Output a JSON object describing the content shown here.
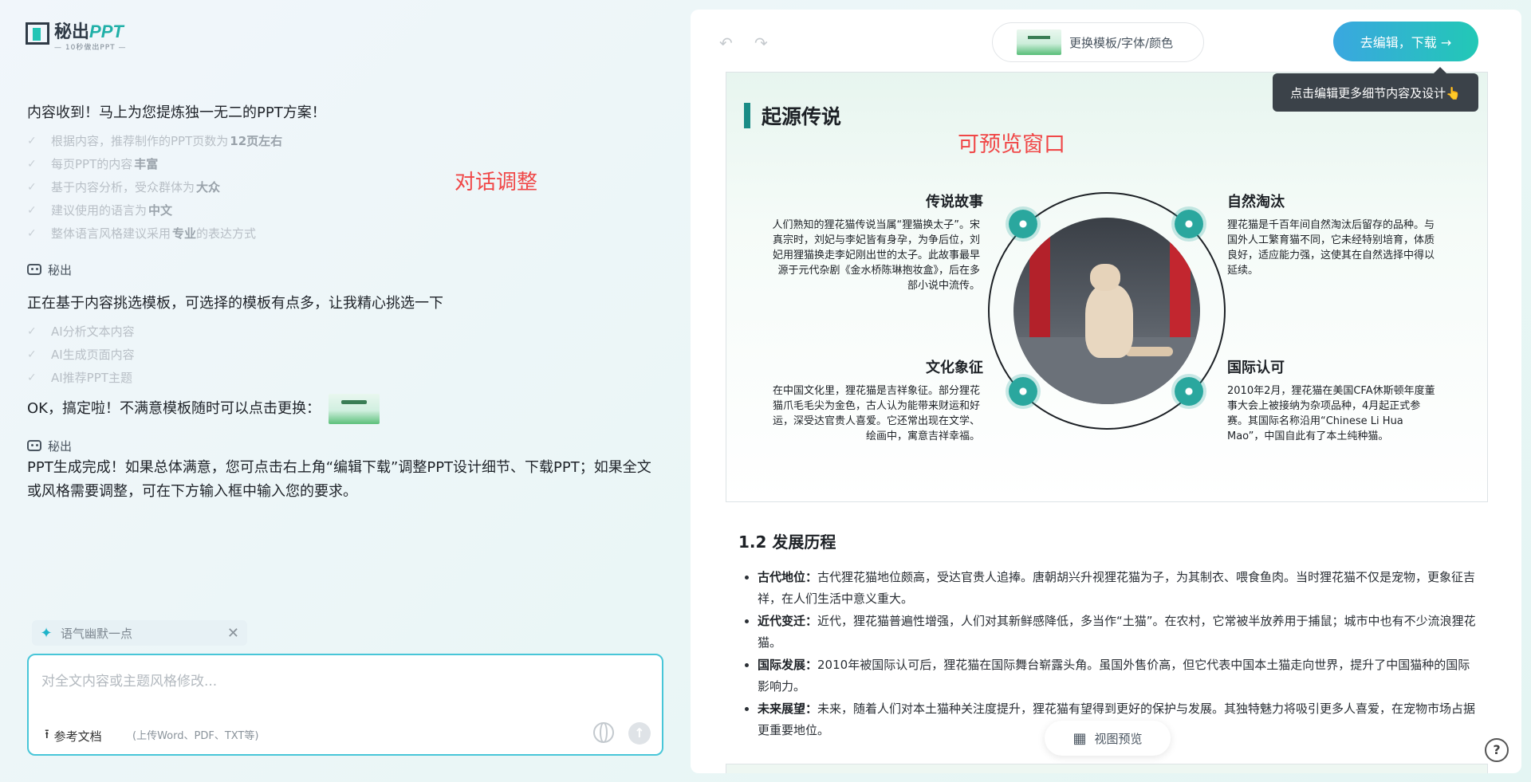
{
  "logo": {
    "brand": "秘出",
    "ppt": "PPT",
    "tagline": "— 10秒做出PPT —"
  },
  "chat": {
    "intro": "内容收到！马上为您提炼独一无二的PPT方案！",
    "checks": [
      {
        "text": "根据内容，推荐制作的PPT页数为",
        "bold": "12页左右"
      },
      {
        "text": "每页PPT的内容",
        "bold": "丰富"
      },
      {
        "text": "基于内容分析，受众群体为",
        "bold": "大众"
      },
      {
        "text": "建议使用的语言为",
        "bold": "中文"
      },
      {
        "text": "整体语言风格建议采用",
        "bold": "专业",
        "suffix": "的表达方式"
      }
    ],
    "bot_name": "秘出",
    "picking": "正在基于内容挑选模板，可选择的模板有点多，让我精心挑选一下",
    "steps": [
      "AI分析文本内容",
      "AI生成页面内容",
      "AI推荐PPT主题"
    ],
    "ok": "OK，搞定啦！不满意模板随时可以点击更换：",
    "bot_name_2": "秘出",
    "final": "PPT生成完成！如果总体满意，您可点击右上角“编辑下载”调整PPT设计细节、下载PPT；如果全文或风格需要调整，可在下方输入框中输入您的要求。"
  },
  "annotations": {
    "left": "对话调整",
    "right": "可预览窗口"
  },
  "input": {
    "chip": "语气幽默一点",
    "placeholder": "对全文内容或主题风格修改...",
    "ref_label": "参考文档",
    "ref_hint": "(上传Word、PDF、TXT等)"
  },
  "toolbar": {
    "template_label": "更换模板/字体/颜色",
    "edit_label": "去编辑，下载 →",
    "tooltip": "点击编辑更多细节内容及设计👆"
  },
  "slide": {
    "title": "起源传说",
    "sections": [
      {
        "heading": "传说故事",
        "body": "人们熟知的狸花猫传说当属“狸猫换太子”。宋真宗时，刘妃与李妃皆有身孕，为争后位，刘妃用狸猫换走李妃刚出世的太子。此故事最早源于元代杂剧《金水桥陈琳抱妆盒》，后在多部小说中流传。"
      },
      {
        "heading": "自然淘汰",
        "body": "狸花猫是千百年间自然淘汰后留存的品种。与国外人工繁育猫不同，它未经特别培育，体质良好，适应能力强，这使其在自然选择中得以延续。"
      },
      {
        "heading": "文化象征",
        "body": "在中国文化里，狸花猫是吉祥象征。部分狸花猫爪毛毛尖为金色，古人认为能带来财运和好运，深受达官贵人喜爱。它还常出现在文学、绘画中，寓意吉祥幸福。"
      },
      {
        "heading": "国际认可",
        "body": "2010年2月，狸花猫在美国CFA休斯顿年度董事大会上被接纳为杂项品种，4月起正式参赛。其国际名称沿用“Chinese Li Hua Mao”，中国自此有了本土纯种猫。"
      }
    ]
  },
  "article": {
    "heading": "1.2 发展历程",
    "items": [
      {
        "label": "古代地位：",
        "text": "古代狸花猫地位颇高，受达官贵人追捧。唐朝胡兴升视狸花猫为子，为其制衣、喂食鱼肉。当时狸花猫不仅是宠物，更象征吉祥，在人们生活中意义重大。"
      },
      {
        "label": "近代变迁：",
        "text": "近代，狸花猫普遍性增强，人们对其新鲜感降低，多当作“土猫”。在农村，它常被半放养用于捕鼠；城市中也有不少流浪狸花猫。"
      },
      {
        "label": "国际发展：",
        "text": "2010年被国际认可后，狸花猫在国际舞台崭露头角。虽国外售价高，但它代表中国本土猫走向世界，提升了中国猫种的国际影响力。"
      },
      {
        "label": "未来展望：",
        "text": "未来，随着人们对本土猫种关注度提升，狸花猫有望得到更好的保护与发展。其独特魅力将吸引更多人喜爱，在宠物市场占据更重要地位。"
      }
    ]
  },
  "view_preview": "视图预览",
  "help": "?"
}
